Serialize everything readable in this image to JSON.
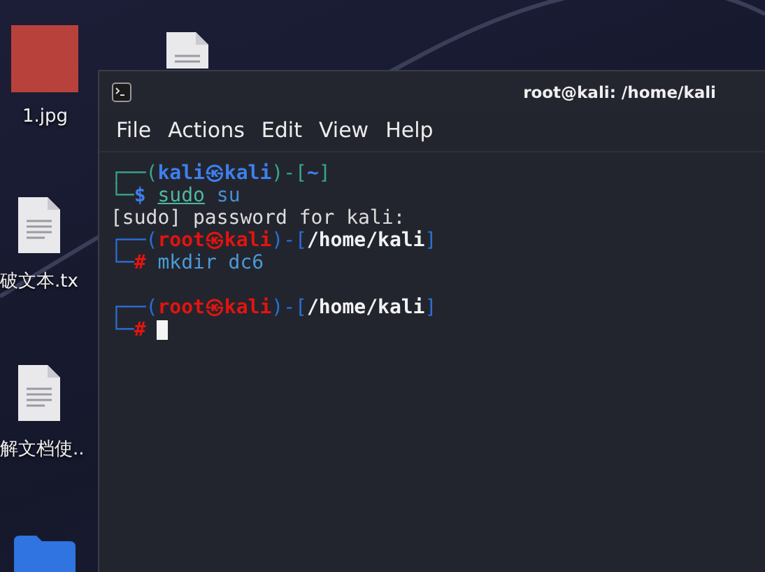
{
  "desktop_icons": [
    {
      "kind": "image",
      "label": "1.jpg"
    },
    {
      "kind": "partial_document"
    },
    {
      "kind": "document",
      "label": "破文本.tx"
    },
    {
      "kind": "document",
      "label": "解文档使.."
    },
    {
      "kind": "folder"
    }
  ],
  "window": {
    "title": "root@kali: /home/kali"
  },
  "menu": [
    "File",
    "Actions",
    "Edit",
    "View",
    "Help"
  ],
  "terminal": {
    "lines": [
      {
        "kind": "user_prompt",
        "cursor": false,
        "segments": [
          {
            "kind": "frame",
            "text": "┌──("
          },
          {
            "kind": "name",
            "text": "kali㉿kali"
          },
          {
            "kind": "frame",
            "text": ")-["
          },
          {
            "kind": "path",
            "text": "~"
          },
          {
            "kind": "frame",
            "text": "]"
          }
        ]
      },
      {
        "kind": "user_command",
        "cursor": false,
        "segments": [
          {
            "kind": "frame",
            "text": "└─"
          },
          {
            "kind": "sign",
            "text": "$"
          },
          {
            "kind": "command",
            "text": "sudo"
          },
          {
            "kind": "argument",
            "text": "su"
          }
        ]
      },
      {
        "kind": "output",
        "cursor": false,
        "segments": [
          {
            "kind": "output",
            "text": "[sudo] password for kali:"
          }
        ]
      },
      {
        "kind": "root_prompt",
        "cursor": false,
        "segments": [
          {
            "kind": "frame",
            "text": "┌──("
          },
          {
            "kind": "name",
            "text": "root㉿kali"
          },
          {
            "kind": "frame",
            "text": ")-["
          },
          {
            "kind": "path",
            "text": "/home/kali"
          },
          {
            "kind": "frame",
            "text": "]"
          }
        ]
      },
      {
        "kind": "root_command",
        "cursor": false,
        "segments": [
          {
            "kind": "frame",
            "text": "└─"
          },
          {
            "kind": "sign",
            "text": "#"
          },
          {
            "kind": "argument",
            "text": "mkdir dc6"
          }
        ]
      },
      {
        "kind": "blank",
        "cursor": false
      },
      {
        "kind": "root_prompt",
        "cursor": false,
        "segments": [
          {
            "kind": "frame",
            "text": "┌──("
          },
          {
            "kind": "name",
            "text": "root㉿kali"
          },
          {
            "kind": "frame",
            "text": ")-["
          },
          {
            "kind": "path",
            "text": "/home/kali"
          },
          {
            "kind": "frame",
            "text": "]"
          }
        ]
      },
      {
        "kind": "root_command",
        "cursor": true,
        "segments": [
          {
            "kind": "frame",
            "text": "└─"
          },
          {
            "kind": "sign",
            "text": "#"
          }
        ]
      }
    ]
  }
}
